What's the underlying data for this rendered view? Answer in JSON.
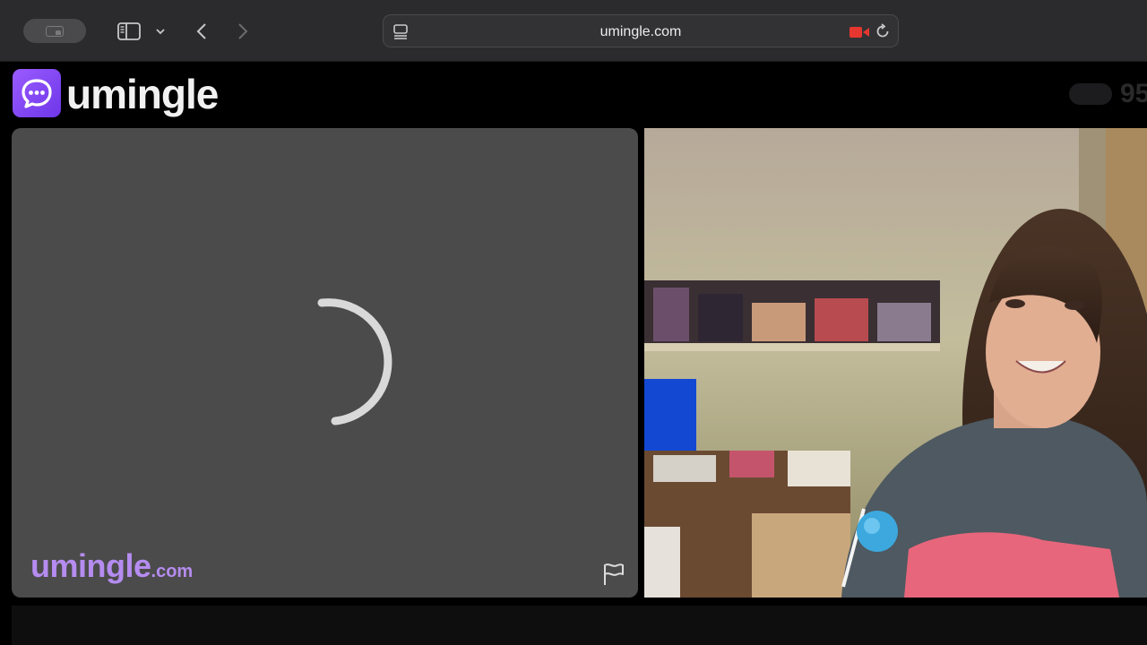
{
  "browser": {
    "url": "umingle.com"
  },
  "header": {
    "logo_text": "umingle",
    "online_count": "95"
  },
  "left_panel": {
    "watermark_main": "umingle",
    "watermark_suffix": ".com"
  },
  "colors": {
    "accent": "#8b4df7",
    "watermark": "#b58cf0",
    "record": "#e5372f"
  }
}
